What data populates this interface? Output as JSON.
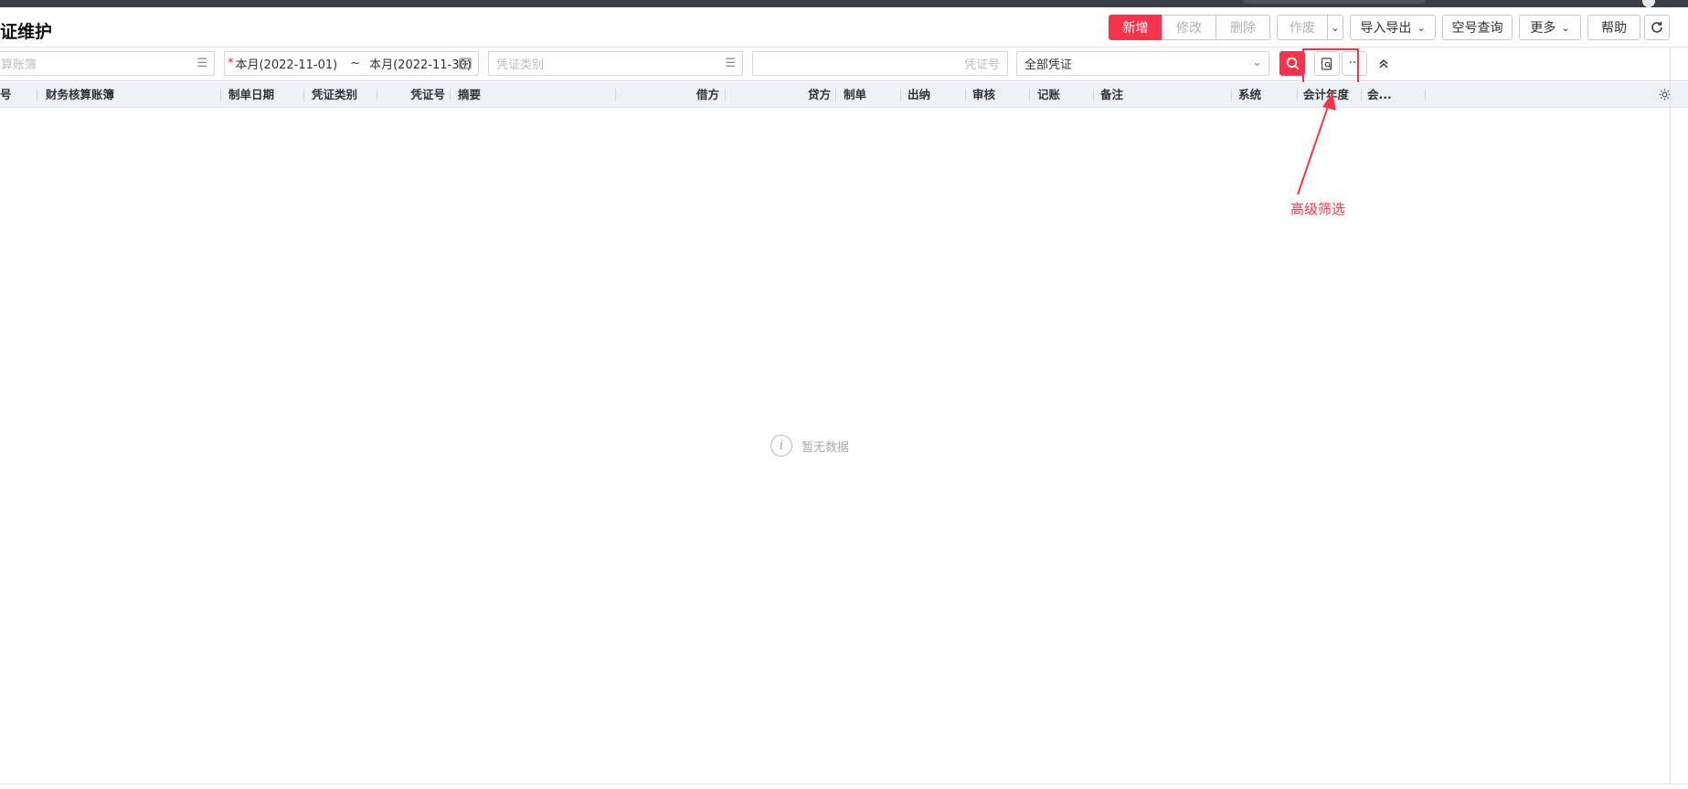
{
  "header": {
    "title": "证维护",
    "buttons": {
      "add": "新增",
      "edit": "修改",
      "delete": "删除",
      "void": "作废",
      "import_export": "导入导出",
      "empty_no_query": "空号查询",
      "more": "更多",
      "help": "帮助"
    }
  },
  "filters": {
    "ledger_placeholder": "算账簿",
    "date_start": "本月(2022-11-01)",
    "date_separator": "~",
    "date_end": "本月(2022-11-30)",
    "voucher_type_placeholder": "凭证类别",
    "voucher_no_placeholder": "凭证号",
    "voucher_scope": "全部凭证"
  },
  "table": {
    "columns": [
      "号",
      "财务核算账簿",
      "制单日期",
      "凭证类别",
      "凭证号",
      "摘要",
      "借方",
      "贷方",
      "制单",
      "出纳",
      "审核",
      "记账",
      "备注",
      "系统",
      "会计年度",
      "会..."
    ]
  },
  "empty_state": {
    "text": "暂无数据"
  },
  "annotation": {
    "label": "高级筛选"
  },
  "colors": {
    "accent": "#f5344b",
    "header_bg": "#eef1f8"
  }
}
